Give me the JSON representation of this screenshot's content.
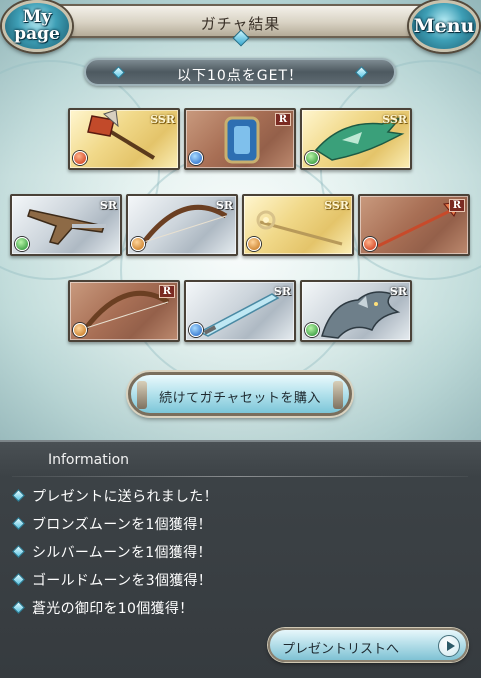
{
  "header": {
    "title": "ガチャ結果",
    "mypage_label_line1": "My",
    "mypage_label_line2": "page",
    "menu_label": "Menu"
  },
  "banner": {
    "text": "以下10点をGET！"
  },
  "items": [
    {
      "rarity": "SSR",
      "element": "fire",
      "icon": "axe-icon"
    },
    {
      "rarity": "R",
      "element": "water",
      "icon": "shield-icon"
    },
    {
      "rarity": "SSR",
      "element": "wind",
      "icon": "dragon-claw-icon"
    },
    {
      "rarity": "SR",
      "element": "wind",
      "icon": "gun-icon"
    },
    {
      "rarity": "SR",
      "element": "earth",
      "icon": "bow-icon"
    },
    {
      "rarity": "SSR",
      "element": "earth",
      "icon": "staff-icon"
    },
    {
      "rarity": "R",
      "element": "fire",
      "icon": "spear-icon"
    },
    {
      "rarity": "R",
      "element": "earth",
      "icon": "bow-icon"
    },
    {
      "rarity": "SR",
      "element": "water",
      "icon": "sword-icon"
    },
    {
      "rarity": "SR",
      "element": "wind",
      "icon": "dragon-summon-icon"
    }
  ],
  "buy_button": {
    "label": "続けてガチャセットを購入"
  },
  "info": {
    "title": "Information",
    "lines": [
      "プレゼントに送られました！",
      "ブロンズムーンを1個獲得！",
      "シルバームーンを1個獲得！",
      "ゴールドムーンを3個獲得！",
      "蒼光の御印を10個獲得！"
    ],
    "present_button_label": "プレゼントリストへ"
  },
  "colors": {
    "ssr": "#f1d98a",
    "sr": "#cdd5dc",
    "r": "#a86f55",
    "panel": "#3c4246",
    "accent": "#5cc4e2"
  }
}
